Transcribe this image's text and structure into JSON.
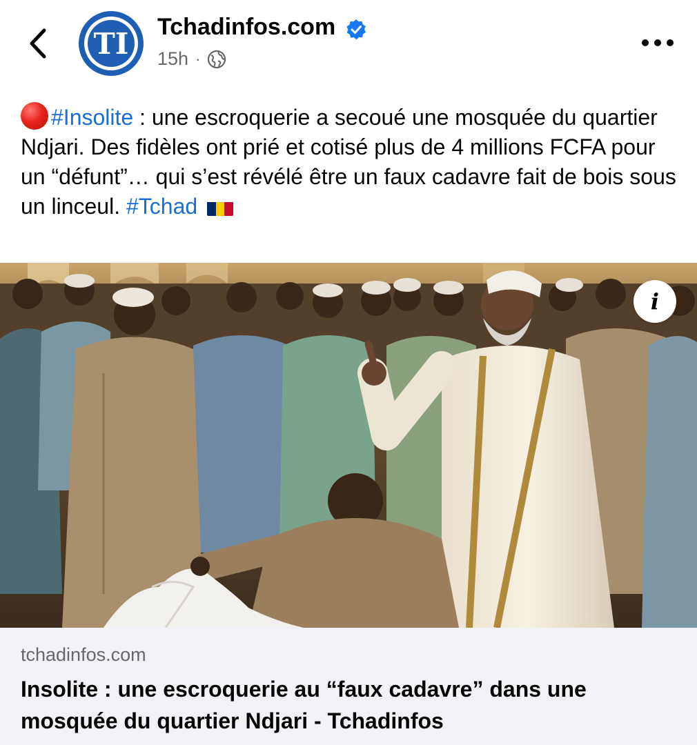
{
  "header": {
    "page_name": "Tchadinfos.com",
    "avatar_initials": "TI",
    "time": "15h",
    "separator": "·",
    "audience_icon": "globe-icon",
    "verified_icon": "verified-badge-icon",
    "back_icon": "chevron-left-icon",
    "more_icon": "more-horizontal-icon"
  },
  "post": {
    "marker_icon": "red-circle-emoji",
    "hashtag_1": "#Insolite",
    "body": " : une escroquerie a secoué une mosquée du quartier Ndjari. Des fidèles ont prié et cotisé plus de 4 millions FCFA pour un “défunt”… qui s’est révélé être un faux cadavre fait de bois sous un linceul. ",
    "hashtag_2": "#Tchad",
    "flag_icon": "chad-flag-emoji",
    "flag_colors": [
      "#002664",
      "#FECB00",
      "#C60C30"
    ]
  },
  "media": {
    "info_label": "i"
  },
  "link_preview": {
    "domain": "tchadinfos.com",
    "title": "Insolite : une escroquerie au “faux cadavre” dans une mosquée du quartier Ndjari - Tchadinfos"
  },
  "colors": {
    "link_blue": "#1a6ed8",
    "avatar_blue": "#1f5fb3",
    "verified_blue": "#1877f2",
    "muted_text": "#65676b",
    "preview_bg": "#f0f2f5"
  }
}
